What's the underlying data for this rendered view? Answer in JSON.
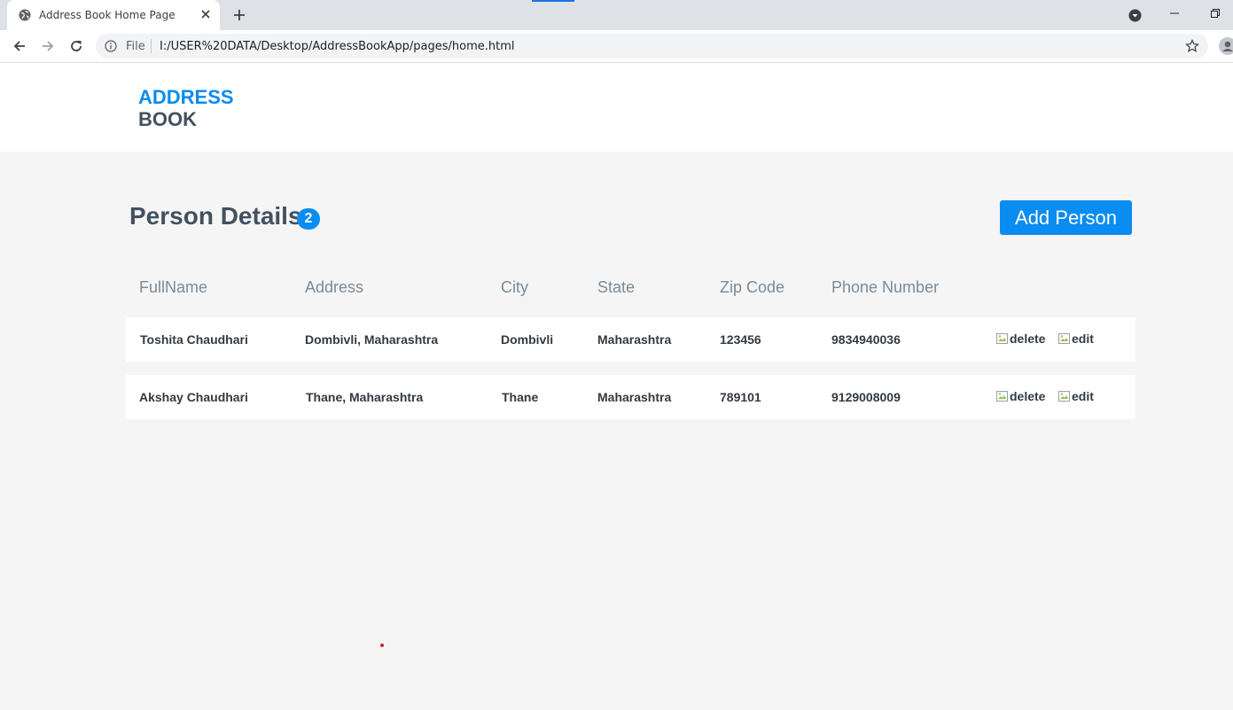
{
  "browser": {
    "tab_title": "Address Book Home Page",
    "scheme_label": "File",
    "url": "I:/USER%20DATA/Desktop/AddressBookApp/pages/home.html",
    "icons": [
      "globe-icon",
      "close-icon",
      "plus-icon",
      "back-icon",
      "forward-icon",
      "reload-icon",
      "info-icon",
      "star-icon",
      "account-icon",
      "dropdown-icon",
      "minimize-icon",
      "restore-icon"
    ]
  },
  "logo": {
    "line1": "ADDRESS",
    "line2": "BOOK"
  },
  "main": {
    "title": "Person Details",
    "count": "2",
    "add_button": "Add Person"
  },
  "table": {
    "columns": [
      "FullName",
      "Address",
      "City",
      "State",
      "Zip Code",
      "Phone Number"
    ],
    "rows": [
      {
        "full_name": "Toshita Chaudhari",
        "address": "Dombivli, Maharashtra",
        "city": "Dombivli",
        "state": "Maharashtra",
        "zip": "123456",
        "phone": "9834940036",
        "delete_alt": "delete",
        "edit_alt": "edit"
      },
      {
        "full_name": "Akshay Chaudhari",
        "address": "Thane, Maharashtra",
        "city": "Thane",
        "state": "Maharashtra",
        "zip": "789101",
        "phone": "9129008009",
        "delete_alt": "delete",
        "edit_alt": "edit"
      }
    ]
  },
  "colors": {
    "accent": "#0a8cf0",
    "text_dark": "#42515f",
    "header_text": "#7a8b9a",
    "page_bg": "#f5f5f5"
  }
}
